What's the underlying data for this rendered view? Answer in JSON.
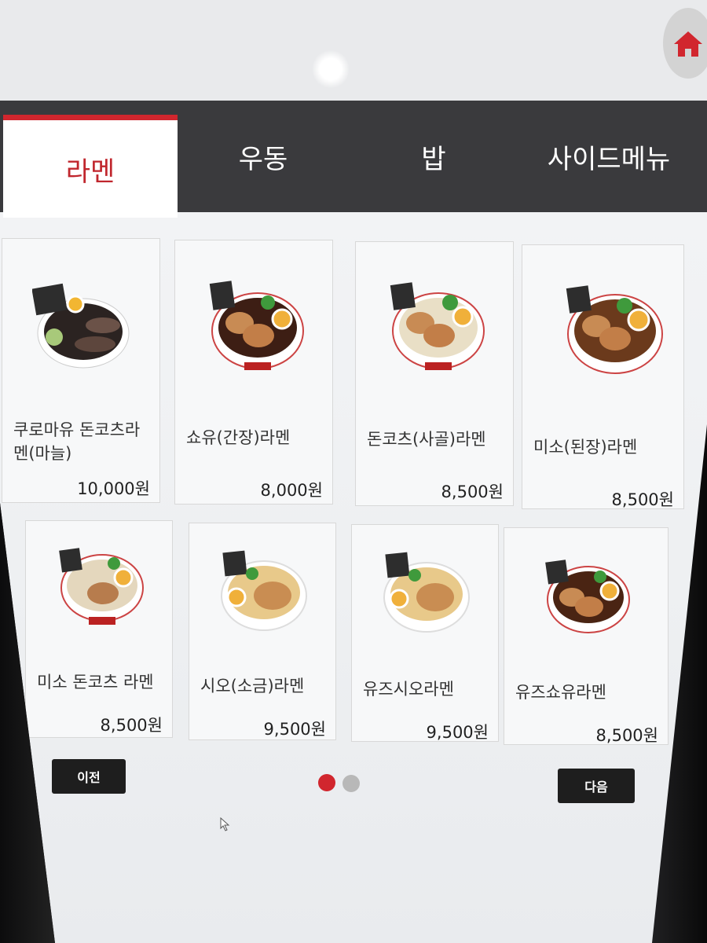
{
  "tabs": [
    {
      "label": "라멘",
      "active": true
    },
    {
      "label": "우동",
      "active": false
    },
    {
      "label": "밥",
      "active": false
    },
    {
      "label": "사이드메뉴",
      "active": false
    }
  ],
  "menu_items": [
    {
      "name": "쿠로마유 돈코츠라멘(마늘)",
      "price": "10,000원"
    },
    {
      "name": "쇼유(간장)라멘",
      "price": "8,000원"
    },
    {
      "name": "돈코츠(사골)라멘",
      "price": "8,500원"
    },
    {
      "name": "미소(된장)라멘",
      "price": "8,500원"
    },
    {
      "name": "미소 돈코츠 라멘",
      "price": "8,500원"
    },
    {
      "name": "시오(소금)라멘",
      "price": "9,500원"
    },
    {
      "name": "유즈시오라멘",
      "price": "9,500원"
    },
    {
      "name": "유즈쇼유라멘",
      "price": "8,500원"
    }
  ],
  "pagination": {
    "prev_label": "이전",
    "next_label": "다음",
    "current_page": 1,
    "total_pages": 2
  },
  "colors": {
    "accent": "#d1262e",
    "tabbar": "#3a3a3d",
    "dot_inactive": "#b8b8b8"
  },
  "icons": {
    "home": "home-icon"
  }
}
